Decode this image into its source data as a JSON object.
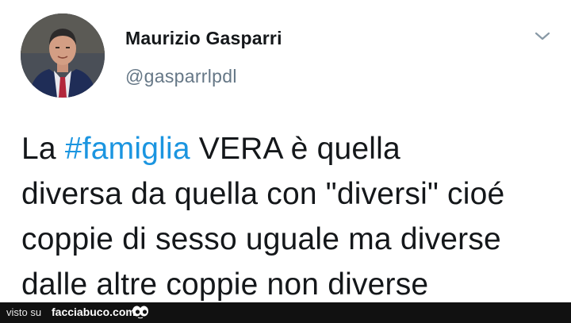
{
  "tweet": {
    "author": {
      "display_name": "Maurizio Gasparri",
      "handle": "@gasparrlpdl",
      "avatar_icon": "person-avatar"
    },
    "menu_icon": "chevron-down-icon",
    "text_lines": {
      "line1_before": "La ",
      "line1_hashtag": "#famiglia",
      "line1_after": " VERA è quella",
      "line2": "diversa da quella con \"diversi\" cioé",
      "line3": "coppie di sesso uguale ma diverse",
      "line4": "dalle altre coppie non diverse"
    },
    "colors": {
      "text": "#14171a",
      "hashtag": "#1b95e0",
      "handle": "#657786"
    }
  },
  "footer": {
    "label": "visto su",
    "site": "facciabuco.com",
    "logo_icon": "eyes-logo-icon",
    "background": "#111111"
  }
}
